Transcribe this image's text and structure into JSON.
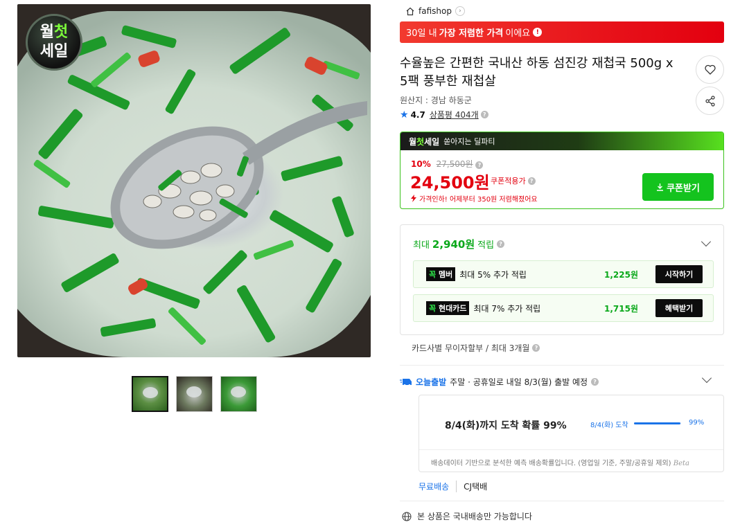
{
  "product_image": {
    "badge_line1_a": "월",
    "badge_line1_b": "첫",
    "badge_line2": "세일",
    "thumbnails": 3
  },
  "shop": {
    "name": "fafishop",
    "arrow": "›"
  },
  "promo_banner": {
    "prefix": "30일 내",
    "bold": "가장 저렴한 가격",
    "suffix": "이에요",
    "info_icon": "info-icon"
  },
  "title": "수율높은 간편한 국내산 하동 섬진강 재첩국 500g x 5팩 풍부한 재첩살",
  "origin": "원산지 : 경남 하동군",
  "rating": {
    "score": "4.7",
    "review_label": "상품평 404개"
  },
  "deal": {
    "brand_a": "월",
    "brand_b": "첫",
    "brand_c": "세일",
    "headline": "쏟아지는 딜파티",
    "discount_pct": "10%",
    "original_price": "27,500원",
    "price": "24,500원",
    "coupon_note": "쿠폰적용가",
    "drop_note": "가격인하! 어제부터 350원 저렴해졌어요",
    "coupon_button": "쿠폰받기"
  },
  "reward": {
    "prefix": "최대",
    "amount": "2,940원",
    "suffix": "적립",
    "rows": [
      {
        "tag_a": "꼭",
        "tag_b": "멤버",
        "label": "최대 5% 추가 적립",
        "amount": "1,225원",
        "button": "시작하기"
      },
      {
        "tag_a": "꼭",
        "tag_b": "현대카드",
        "label": "최대 7% 추가 적립",
        "amount": "1,715원",
        "button": "혜택받기"
      }
    ]
  },
  "installment": "카드사별 무이자할부 / 최대 3개월",
  "shipping": {
    "today_label": "오늘출발",
    "text": "주말 · 공휴일로 내일 8/3(월) 출발 예정",
    "predict_big": "8/4(화)까지 도착 확률 99%",
    "predict_small": "8/4(화) 도착",
    "predict_pct": "99%",
    "predict_fraction": 0.99,
    "predict_foot": "배송데이터 기반으로 분석한 예측 배송확률입니다. (영업일 기준, 주말/공휴일 제외)",
    "beta": "Beta",
    "free_label": "무료배송",
    "carrier": "CJ택배"
  },
  "domestic_note": "본 상품은 국내배송만 가능합니다",
  "colors": {
    "accent_red": "#e3000f",
    "accent_green": "#14c31e",
    "accent_blue": "#1a73e8"
  }
}
